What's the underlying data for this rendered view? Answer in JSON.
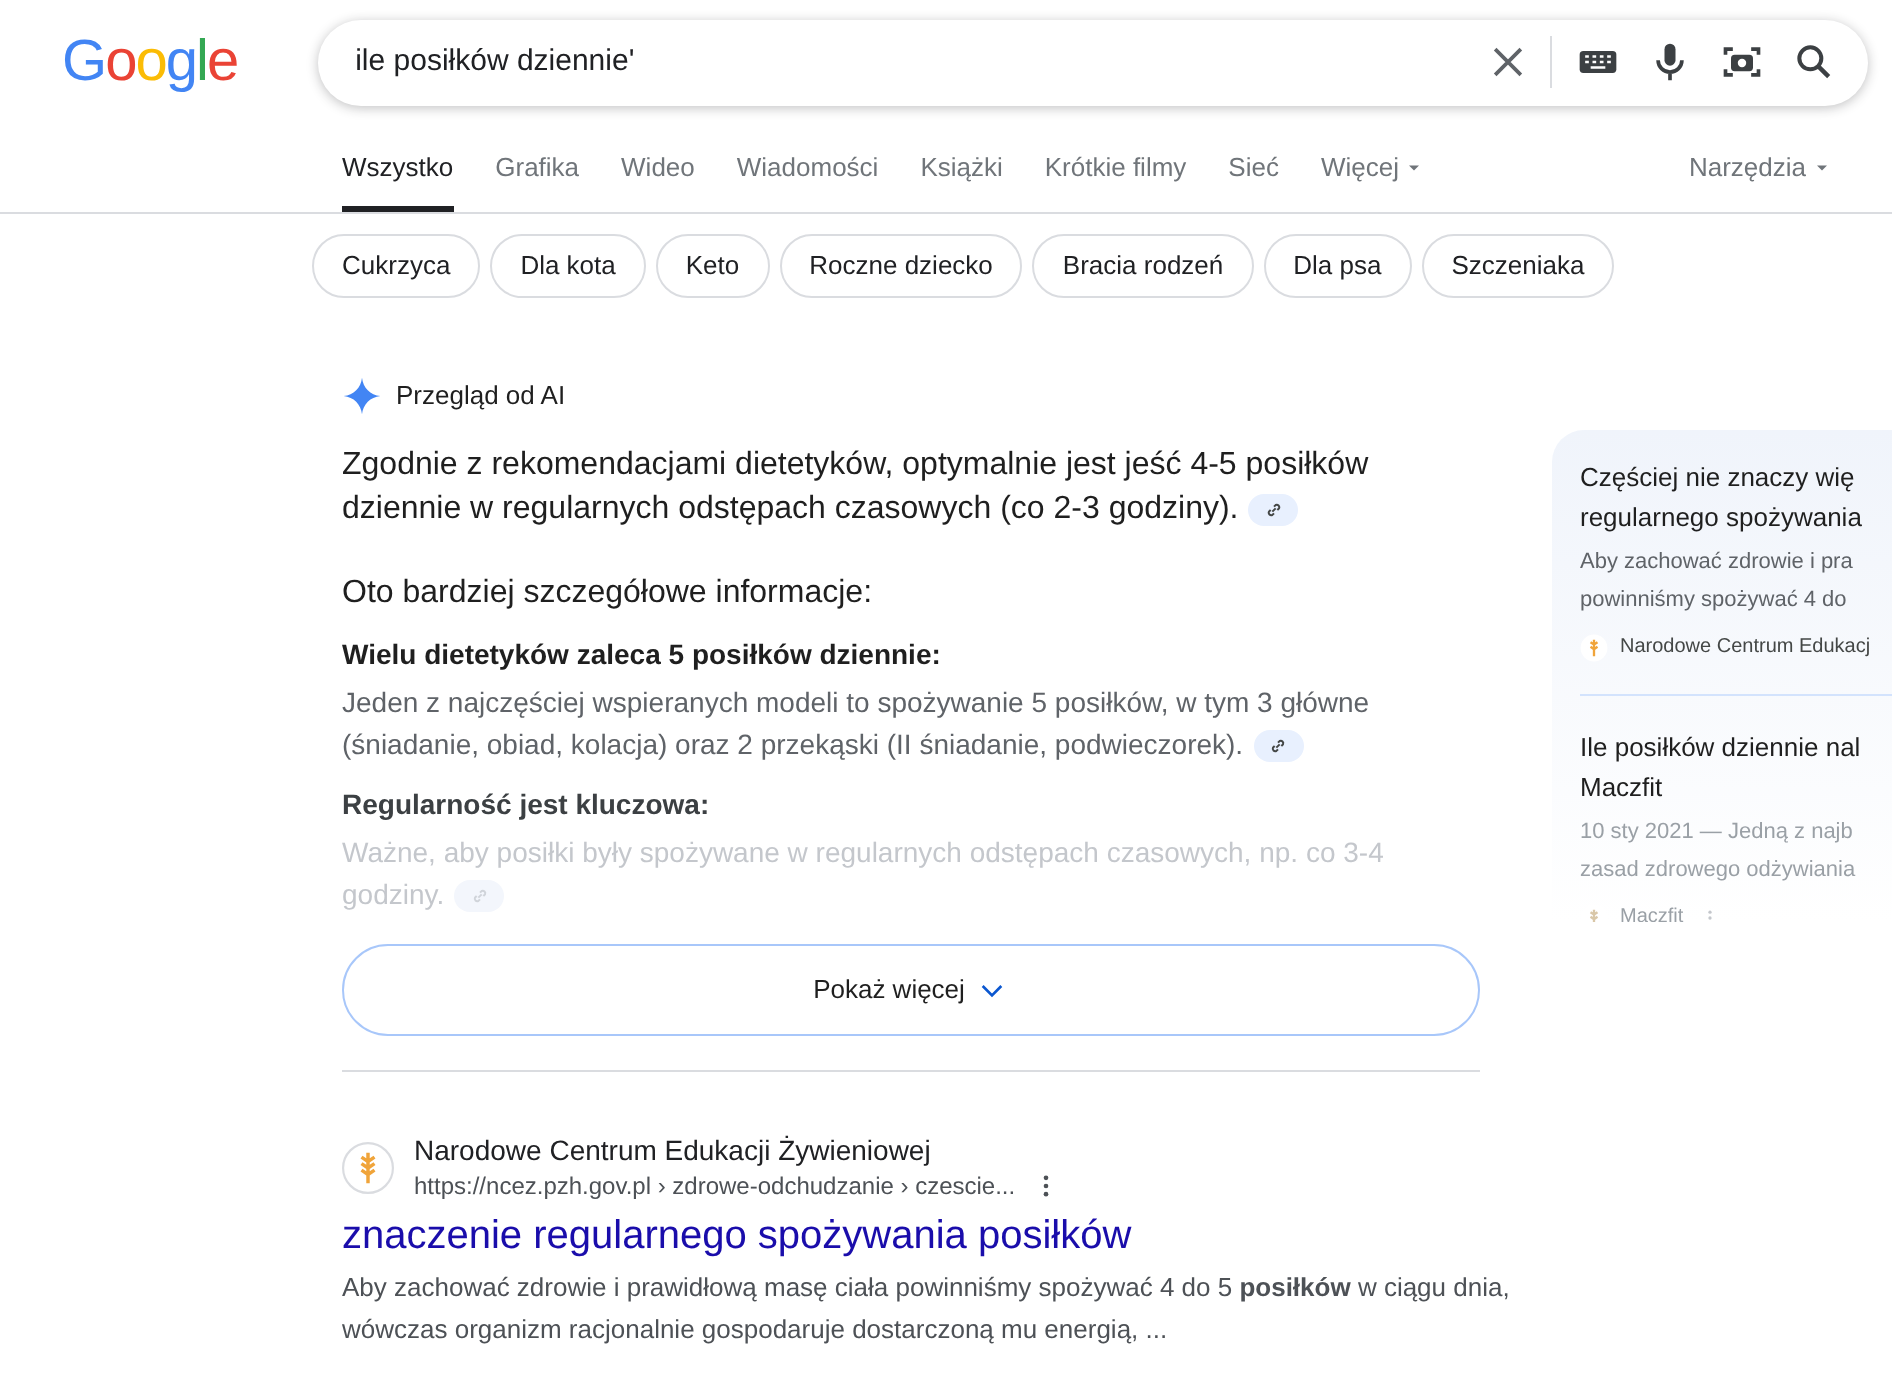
{
  "logo": "Google",
  "search": {
    "query": "ile posiłków dziennie'"
  },
  "tabs": [
    {
      "label": "Wszystko",
      "selected": true
    },
    {
      "label": "Grafika",
      "selected": false
    },
    {
      "label": "Wideo",
      "selected": false
    },
    {
      "label": "Wiadomości",
      "selected": false
    },
    {
      "label": "Książki",
      "selected": false
    },
    {
      "label": "Krótkie filmy",
      "selected": false
    },
    {
      "label": "Sieć",
      "selected": false
    },
    {
      "label": "Więcej",
      "selected": false,
      "dropdown": true
    }
  ],
  "tools": "Narzędzia",
  "chips": [
    "Cukrzyca",
    "Dla kota",
    "Keto",
    "Roczne dziecko",
    "Bracia rodzeń",
    "Dla psa",
    "Szczeniaka"
  ],
  "ai_overview": {
    "label": "Przegląd od AI",
    "summary": "Zgodnie z rekomendacjami dietetyków, optymalnie jest jeść 4-5 posiłków dziennie w regularnych odstępach czasowych (co 2-3 godziny).",
    "intro": "Oto bardziej szczegółowe informacje:",
    "sections": [
      {
        "heading": "Wielu dietetyków zaleca 5 posiłków dziennie:",
        "text": "Jeden z najczęściej wspieranych modeli to spożywanie 5 posiłków, w tym 3 główne (śniadanie, obiad, kolacja) oraz 2 przekąski (II śniadanie, podwieczorek).",
        "faded": false
      },
      {
        "heading": "Regularność jest kluczowa:",
        "text": "Ważne, aby posiłki były spożywane w regularnych odstępach czasowych, np. co 3-4 godziny.",
        "faded": true
      }
    ],
    "show_more": "Pokaż więcej"
  },
  "ai_sources": [
    {
      "title_lines": [
        "Częściej nie znaczy wię",
        "regularnego spożywania"
      ],
      "snippet_lines": [
        "Aby zachować zdrowie i pra",
        "powinniśmy spożywać 4 do"
      ],
      "source": "Narodowe Centrum Edukacj",
      "faded": false
    },
    {
      "title_lines": [
        "Ile posiłków dziennie nal",
        "Maczfit"
      ],
      "snippet_lines": [
        "10 sty 2021 — Jedną z najb",
        "zasad zdrowego odżywiania"
      ],
      "source": "Maczfit",
      "faded": true
    }
  ],
  "results": [
    {
      "site": "Narodowe Centrum Edukacji Żywieniowej",
      "url": "https://ncez.pzh.gov.pl › zdrowe-odchudzanie › czescie...",
      "title": "znaczenie regularnego spożywania posiłków",
      "snippet": "Aby zachować zdrowie i prawidłową masę ciała powinniśmy spożywać 4 do 5 **posiłków** w ciągu dnia, wówczas organizm racjonalnie gospodaruje dostarczoną mu energią, ..."
    }
  ]
}
